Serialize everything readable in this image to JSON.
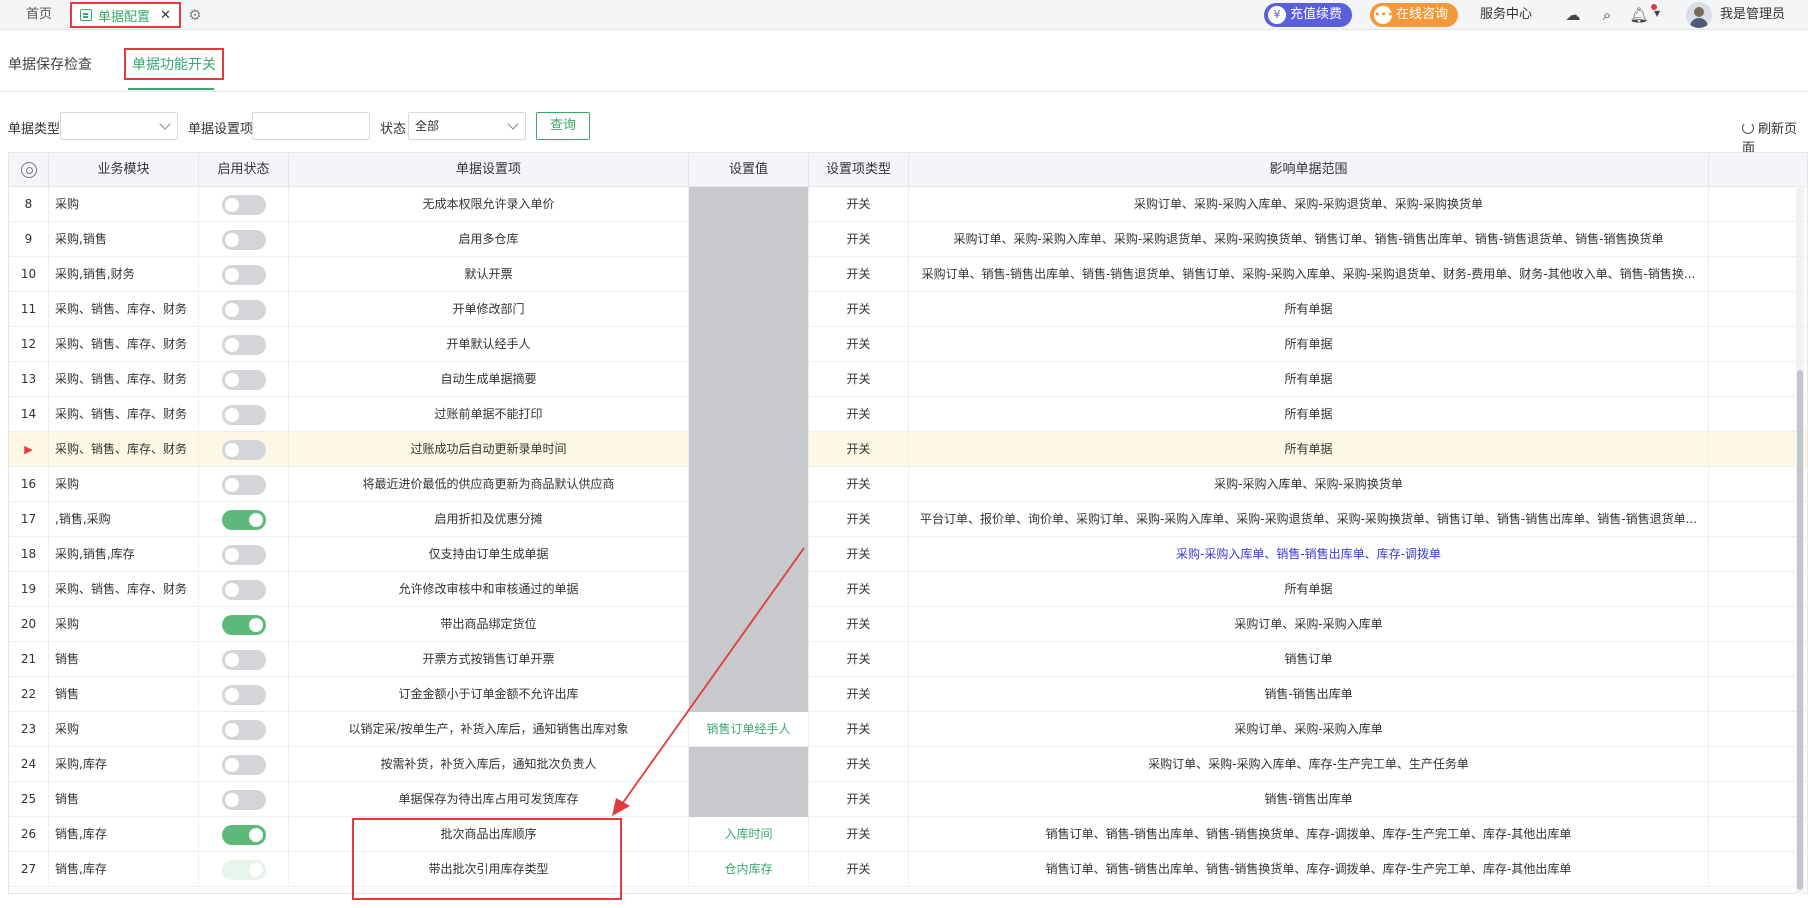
{
  "topbar": {
    "home_tab": "首页",
    "active_tab": "单据配置",
    "close_glyph": "✕",
    "recharge": "充值续费",
    "consult": "在线咨询",
    "service_center": "服务中心",
    "user_name": "我是管理员"
  },
  "subtabs": {
    "tab1": "单据保存检查",
    "tab2": "单据功能开关"
  },
  "filter": {
    "doc_type_label": "单据类型",
    "doc_type_value": "",
    "setting_label": "单据设置项",
    "setting_value": "",
    "status_label": "状态",
    "status_value": "全部",
    "query_button": "查询",
    "refresh": "刷新页面"
  },
  "table": {
    "headers": [
      "业务模块",
      "启用状态",
      "单据设置项",
      "设置值",
      "设置项类型",
      "影响单据范围"
    ],
    "rows": [
      {
        "no": "8",
        "module": "采购",
        "on": false,
        "item": "无成本权限允许录入单价",
        "value": "",
        "gray": true,
        "type": "开关",
        "scope": "采购订单、采购-采购入库单、采购-采购退货单、采购-采购换货单"
      },
      {
        "no": "9",
        "module": "采购,销售",
        "on": false,
        "item": "启用多仓库",
        "value": "",
        "gray": true,
        "type": "开关",
        "scope": "采购订单、采购-采购入库单、采购-采购退货单、采购-采购换货单、销售订单、销售-销售出库单、销售-销售退货单、销售-销售换货单"
      },
      {
        "no": "10",
        "module": "采购,销售,财务",
        "on": false,
        "item": "默认开票",
        "value": "",
        "gray": true,
        "type": "开关",
        "scope": "采购订单、销售-销售出库单、销售-销售退货单、销售订单、采购-采购入库单、采购-采购退货单、财务-费用单、财务-其他收入单、销售-销售换..."
      },
      {
        "no": "11",
        "module": "采购、销售、库存、财务",
        "on": false,
        "item": "开单修改部门",
        "value": "",
        "gray": true,
        "type": "开关",
        "scope": "所有单据"
      },
      {
        "no": "12",
        "module": "采购、销售、库存、财务",
        "on": false,
        "item": "开单默认经手人",
        "value": "",
        "gray": true,
        "type": "开关",
        "scope": "所有单据"
      },
      {
        "no": "13",
        "module": "采购、销售、库存、财务",
        "on": false,
        "item": "自动生成单据摘要",
        "value": "",
        "gray": true,
        "type": "开关",
        "scope": "所有单据"
      },
      {
        "no": "14",
        "module": "采购、销售、库存、财务",
        "on": false,
        "item": "过账前单据不能打印",
        "value": "",
        "gray": true,
        "type": "开关",
        "scope": "所有单据"
      },
      {
        "no": "▶",
        "module": "采购、销售、库存、财务",
        "on": false,
        "item": "过账成功后自动更新录单时间",
        "value": "",
        "gray": true,
        "type": "开关",
        "scope": "所有单据"
      },
      {
        "no": "16",
        "module": "采购",
        "on": false,
        "item": "将最近进价最低的供应商更新为商品默认供应商",
        "value": "",
        "gray": true,
        "type": "开关",
        "scope": "采购-采购入库单、采购-采购换货单"
      },
      {
        "no": "17",
        "module": ",销售,采购",
        "on": true,
        "item": "启用折扣及优惠分摊",
        "value": "",
        "gray": true,
        "type": "开关",
        "scope": "平台订单、报价单、询价单、采购订单、采购-采购入库单、采购-采购退货单、采购-采购换货单、销售订单、销售-销售出库单、销售-销售退货单..."
      },
      {
        "no": "18",
        "module": "采购,销售,库存",
        "on": false,
        "item": "仅支持由订单生成单据",
        "value": "",
        "gray": true,
        "type": "开关",
        "scope": "采购-采购入库单、销售-销售出库单、库存-调拨单"
      },
      {
        "no": "19",
        "module": "采购、销售、库存、财务",
        "on": false,
        "item": "允许修改审核中和审核通过的单据",
        "value": "",
        "gray": true,
        "type": "开关",
        "scope": "所有单据"
      },
      {
        "no": "20",
        "module": "采购",
        "on": true,
        "item": "带出商品绑定货位",
        "value": "",
        "gray": true,
        "type": "开关",
        "scope": "采购订单、采购-采购入库单"
      },
      {
        "no": "21",
        "module": "销售",
        "on": false,
        "item": "开票方式按销售订单开票",
        "value": "",
        "gray": true,
        "type": "开关",
        "scope": "销售订单"
      },
      {
        "no": "22",
        "module": "销售",
        "on": false,
        "item": "订金金额小于订单金额不允许出库",
        "value": "",
        "gray": true,
        "type": "开关",
        "scope": "销售-销售出库单"
      },
      {
        "no": "23",
        "module": "采购",
        "on": false,
        "item": "以销定采/按单生产，补货入库后，通知销售出库对象",
        "value": "销售订单经手人",
        "gray": false,
        "type": "开关",
        "scope": "采购订单、采购-采购入库单"
      },
      {
        "no": "24",
        "module": "采购,库存",
        "on": false,
        "item": "按需补货，补货入库后，通知批次负责人",
        "value": "",
        "gray": true,
        "type": "开关",
        "scope": "采购订单、采购-采购入库单、库存-生产完工单、生产任务单"
      },
      {
        "no": "25",
        "module": "销售",
        "on": false,
        "item": "单据保存为待出库占用可发货库存",
        "value": "",
        "gray": true,
        "type": "开关",
        "scope": "销售-销售出库单"
      },
      {
        "no": "26",
        "module": "销售,库存",
        "on": true,
        "item": "批次商品出库顺序",
        "value": "入库时间",
        "gray": false,
        "type": "开关",
        "scope": "销售订单、销售-销售出库单、销售-销售换货单、库存-调拨单、库存-生产完工单、库存-其他出库单"
      },
      {
        "no": "27",
        "module": "销售,库存",
        "on": "faint",
        "item": "带出批次引用库存类型",
        "value": "仓内库存",
        "gray": false,
        "type": "开关",
        "scope": "销售订单、销售-销售出库单、销售-销售换货单、库存-调拨单、库存-生产完工单、库存-其他出库单"
      }
    ]
  },
  "colors": {
    "accent_green": "#3aa86b",
    "annotation_red": "#e23b3b",
    "highlight_row": "#fdf8e6",
    "scope_blue": "#3b3bd6"
  },
  "icons": [
    "doc-icon",
    "close-icon",
    "gear-icon",
    "wallet-icon",
    "chat-icon",
    "cloud-download-icon",
    "search-icon",
    "bell-icon",
    "avatar",
    "chevron-down-icon",
    "refresh-icon",
    "toggle-switch"
  ]
}
